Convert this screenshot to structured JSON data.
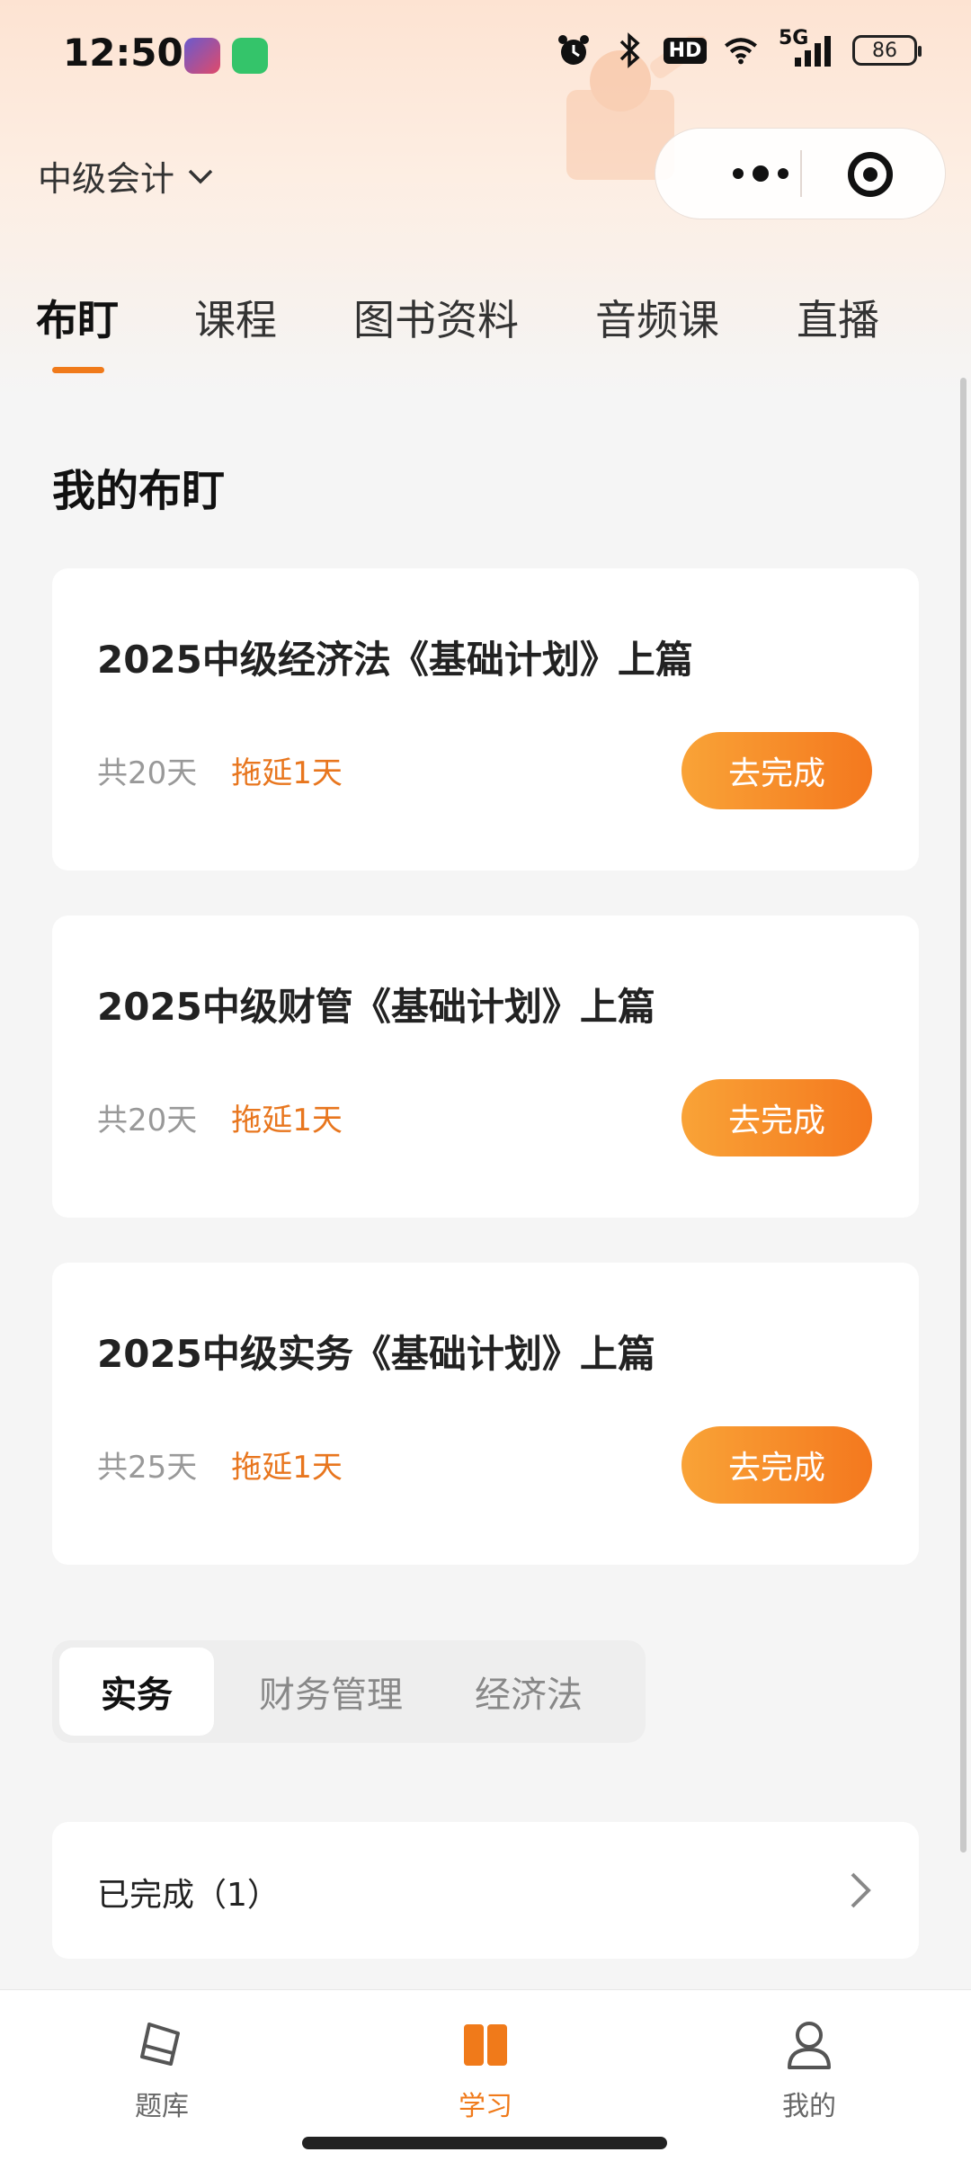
{
  "status_bar": {
    "time": "12:50",
    "network": "5G",
    "hd": "HD",
    "battery": "86",
    "icons": [
      "alarm-icon",
      "bluetooth-icon",
      "hd-icon",
      "wifi-icon",
      "cellular-signal-icon",
      "battery-icon"
    ]
  },
  "header": {
    "subject": "中级会计",
    "subject_icon": "chevron-down-icon",
    "capsule_icons": [
      "more-dots-icon",
      "close-target-icon"
    ]
  },
  "tabs": [
    {
      "label": "布盯",
      "active": true
    },
    {
      "label": "课程",
      "active": false
    },
    {
      "label": "图书资料",
      "active": false
    },
    {
      "label": "音频课",
      "active": false
    },
    {
      "label": "直播",
      "active": false
    }
  ],
  "section": {
    "title": "我的布盯"
  },
  "plans": [
    {
      "title": "2025中级经济法《基础计划》上篇",
      "days": "共20天",
      "delay": "拖延1天",
      "button": "去完成"
    },
    {
      "title": "2025中级财管《基础计划》上篇",
      "days": "共20天",
      "delay": "拖延1天",
      "button": "去完成"
    },
    {
      "title": "2025中级实务《基础计划》上篇",
      "days": "共25天",
      "delay": "拖延1天",
      "button": "去完成"
    }
  ],
  "segment": {
    "items": [
      {
        "label": "实务",
        "active": true
      },
      {
        "label": "财务管理",
        "active": false
      },
      {
        "label": "经济法",
        "active": false
      }
    ]
  },
  "completed": {
    "label": "已完成（1）"
  },
  "bottom_nav": [
    {
      "label": "题库",
      "icon": "question-bank-icon",
      "active": false
    },
    {
      "label": "学习",
      "icon": "study-book-icon",
      "active": true
    },
    {
      "label": "我的",
      "icon": "profile-icon",
      "active": false
    }
  ],
  "colors": {
    "accent": "#f07a1a",
    "delay_text": "#e8761e",
    "button_start": "#f9a337",
    "button_end": "#f4781e"
  }
}
